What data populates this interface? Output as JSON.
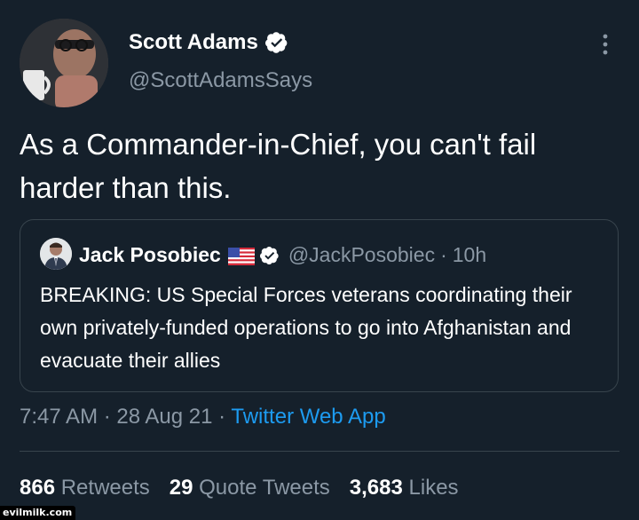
{
  "tweet": {
    "author_name": "Scott Adams",
    "author_handle": "@ScottAdamsSays",
    "text": "As a Commander-in-Chief, you can't fail harder than this.",
    "timestamp": "7:47 AM · 28 Aug 21 · ",
    "source_app": "Twitter Web App"
  },
  "quoted": {
    "author_name": "Jack Posobiec",
    "author_handle": "@JackPosobiec",
    "separator": "·",
    "time": "10h",
    "text": "BREAKING: US Special Forces veterans coordinating their own privately-funded operations to go into Afghanistan and evacuate their allies"
  },
  "stats": {
    "retweets_count": "866",
    "retweets_label": " Retweets",
    "quotes_count": "29",
    "quotes_label": " Quote Tweets",
    "likes_count": "3,683",
    "likes_label": " Likes"
  },
  "watermark": "evilmilk.com",
  "colors": {
    "background": "#15202b",
    "secondary_text": "#8b98a5",
    "link": "#1d9bf0",
    "verified": "#ffffff"
  },
  "icons": [
    "verified-badge-icon",
    "more-options-icon",
    "us-flag-icon"
  ]
}
